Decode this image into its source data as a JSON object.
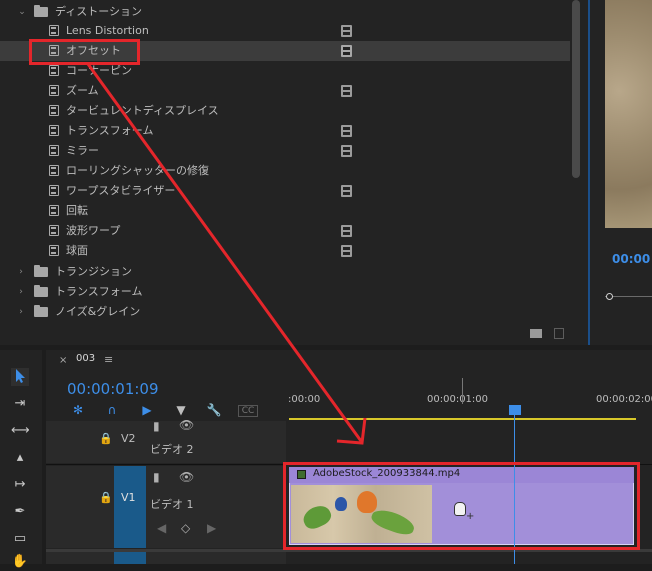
{
  "effects": {
    "folder_open": "ディストーション",
    "items": [
      {
        "label": "Lens Distortion",
        "accel": true
      },
      {
        "label": "オフセット",
        "accel": true
      },
      {
        "label": "コーナーピン",
        "accel": false
      },
      {
        "label": "ズーム",
        "accel": true
      },
      {
        "label": "タービュレントディスプレイス",
        "accel": false
      },
      {
        "label": "トランスフォーム",
        "accel": true
      },
      {
        "label": "ミラー",
        "accel": true
      },
      {
        "label": "ローリングシャッターの修復",
        "accel": false
      },
      {
        "label": "ワープスタビライザー",
        "accel": true
      },
      {
        "label": "回転",
        "accel": false
      },
      {
        "label": "波形ワープ",
        "accel": true
      },
      {
        "label": "球面",
        "accel": true
      }
    ],
    "folders_closed": [
      "トランジション",
      "トランスフォーム",
      "ノイズ&グレイン"
    ]
  },
  "monitor": {
    "timecode": "00:00"
  },
  "timeline": {
    "tab_close": "×",
    "tab_name": "003",
    "tab_menu": "≡",
    "timecode": "00:00:01:09",
    "ruler_labels": [
      ":00:00",
      "00:00:01:00",
      "00:00:02:00"
    ],
    "tracks": {
      "v2": {
        "name": "V2",
        "label": "ビデオ 2"
      },
      "v1": {
        "name": "V1",
        "label": "ビデオ 1"
      }
    },
    "clip": {
      "name": "AdobeStock_200933844.mp4"
    }
  },
  "colors": {
    "accent_blue": "#3d8ee8",
    "annotation_red": "#e4262b",
    "clip_purple": "#a28fd9"
  }
}
